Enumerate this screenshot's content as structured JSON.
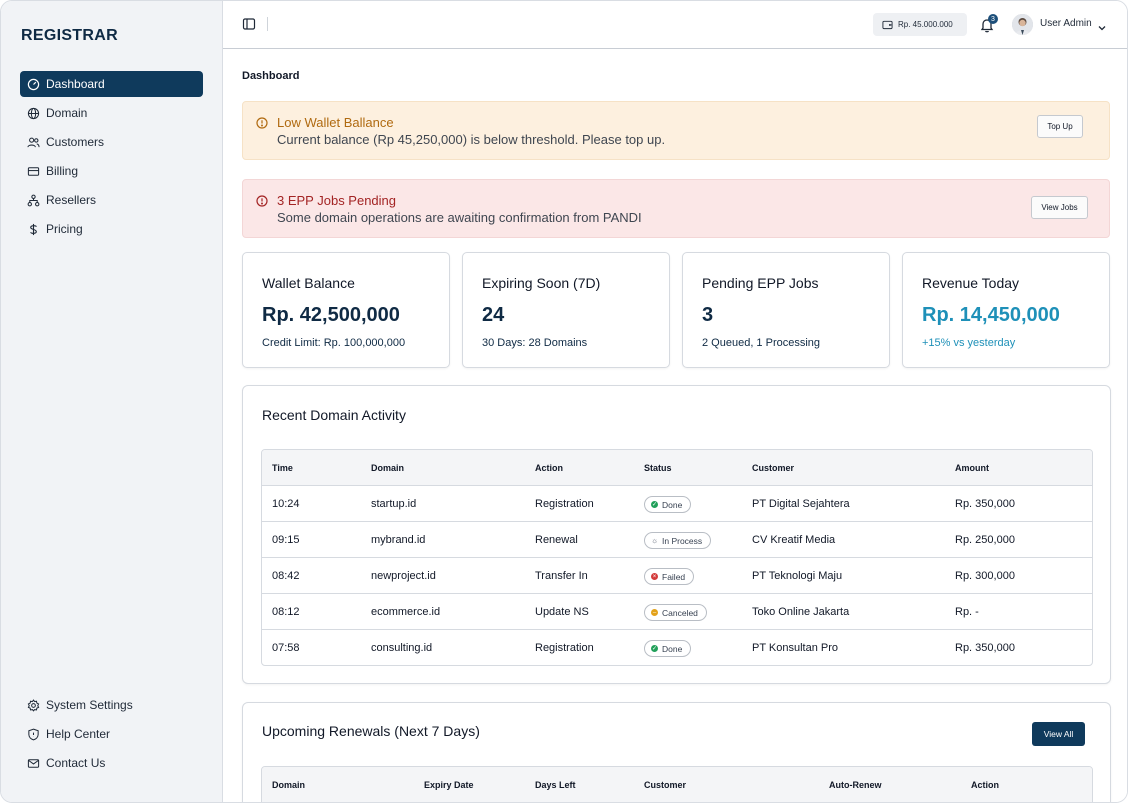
{
  "app": {
    "brand": "REGISTRAR"
  },
  "sidebar": {
    "items": [
      {
        "label": "Dashboard",
        "icon": "gauge-icon",
        "active": true
      },
      {
        "label": "Domain",
        "icon": "globe-icon"
      },
      {
        "label": "Customers",
        "icon": "users-icon"
      },
      {
        "label": "Billing",
        "icon": "credit-card-icon"
      },
      {
        "label": "Resellers",
        "icon": "network-icon"
      },
      {
        "label": "Pricing",
        "icon": "dollar-icon"
      }
    ],
    "bottom_items": [
      {
        "label": "System Settings",
        "icon": "gear-icon"
      },
      {
        "label": "Help Center",
        "icon": "shield-icon"
      },
      {
        "label": "Contact Us",
        "icon": "mail-icon"
      }
    ]
  },
  "header": {
    "wallet_balance": "Rp. 45.000.000",
    "notification_count": "3",
    "user_name": "User Admin"
  },
  "page": {
    "title": "Dashboard"
  },
  "alerts": {
    "wallet": {
      "title": "Low Wallet Ballance",
      "message": "Current balance (Rp 45,250,000) is below threshold. Please top up.",
      "button": "Top Up"
    },
    "epp": {
      "title": "3 EPP Jobs Pending",
      "message": "Some domain operations are awaiting confirmation from PANDI",
      "button": "View Jobs"
    }
  },
  "stats": [
    {
      "label": "Wallet Balance",
      "value": "Rp. 42,500,000",
      "sub": "Credit Limit: Rp. 100,000,000"
    },
    {
      "label": "Expiring Soon (7D)",
      "value": "24",
      "sub": "30 Days: 28 Domains"
    },
    {
      "label": "Pending EPP Jobs",
      "value": "3",
      "sub": "2 Queued, 1 Processing"
    },
    {
      "label": "Revenue Today",
      "value": "Rp. 14,450,000",
      "sub": "+15% vs yesterday"
    }
  ],
  "activity": {
    "title": "Recent Domain Activity",
    "columns": [
      "Time",
      "Domain",
      "Action",
      "Status",
      "Customer",
      "Amount"
    ],
    "rows": [
      {
        "time": "10:24",
        "domain": "startup.id",
        "action": "Registration",
        "status": "Done",
        "customer": "PT Digital Sejahtera",
        "amount": "Rp. 350,000"
      },
      {
        "time": "09:15",
        "domain": "mybrand.id",
        "action": "Renewal",
        "status": "In Process",
        "customer": "CV Kreatif Media",
        "amount": "Rp. 250,000"
      },
      {
        "time": "08:42",
        "domain": "newproject.id",
        "action": "Transfer In",
        "status": "Failed",
        "customer": "PT Teknologi Maju",
        "amount": "Rp. 300,000"
      },
      {
        "time": "08:12",
        "domain": "ecommerce.id",
        "action": "Update NS",
        "status": "Canceled",
        "customer": "Toko Online Jakarta",
        "amount": "Rp. -"
      },
      {
        "time": "07:58",
        "domain": "consulting.id",
        "action": "Registration",
        "status": "Done",
        "customer": "PT Konsultan Pro",
        "amount": "Rp. 350,000"
      }
    ]
  },
  "renewals": {
    "title": "Upcoming Renewals (Next 7 Days)",
    "view_all": "View All",
    "columns": [
      "Domain",
      "Expiry Date",
      "Days Left",
      "Customer",
      "Auto-Renew",
      "Action"
    ]
  },
  "colors": {
    "primary": "#0f3a5c",
    "accent": "#1e90b8",
    "warn_bg": "#fdf0df",
    "danger_bg": "#fbe7e7",
    "status_done": "#22a05a",
    "status_failed": "#d33b3b",
    "status_canceled": "#e3a21a",
    "status_in_process": "#9ca3af"
  }
}
